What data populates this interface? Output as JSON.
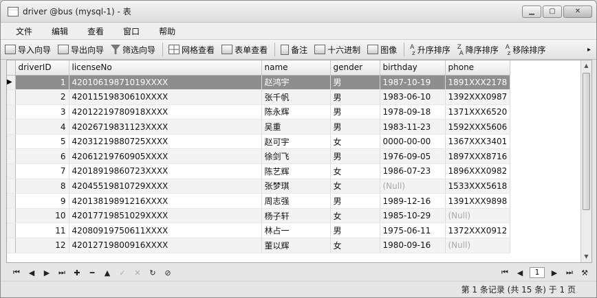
{
  "window": {
    "title": "driver @bus (mysql-1) - 表"
  },
  "menu": [
    "文件",
    "编辑",
    "查看",
    "窗口",
    "帮助"
  ],
  "toolbar": {
    "import_wizard": "导入向导",
    "export_wizard": "导出向导",
    "filter_wizard": "筛选向导",
    "grid_view": "网格查看",
    "form_view": "表单查看",
    "memo": "备注",
    "hex": "十六进制",
    "image": "图像",
    "sort_asc": "升序排序",
    "sort_desc": "降序排序",
    "remove_sort": "移除排序"
  },
  "table": {
    "columns": [
      "driverID",
      "licenseNo",
      "name",
      "gender",
      "birthday",
      "phone"
    ],
    "rows": [
      [
        "1",
        "42010619871019XXXX",
        "赵鸿宇",
        "男",
        "1987-10-19",
        "1891XXX2178"
      ],
      [
        "2",
        "42011519830610XXXX",
        "张千帆",
        "男",
        "1983-06-10",
        "1392XXX0987"
      ],
      [
        "3",
        "42012219780918XXXX",
        "陈永辉",
        "男",
        "1978-09-18",
        "1371XXX6520"
      ],
      [
        "4",
        "42026719831123XXXX",
        "吴重",
        "男",
        "1983-11-23",
        "1592XXX5606"
      ],
      [
        "5",
        "42031219880725XXXX",
        "赵可宇",
        "女",
        "0000-00-00",
        "1367XXX3401"
      ],
      [
        "6",
        "42061219760905XXXX",
        "徐剑飞",
        "男",
        "1976-09-05",
        "1897XXX8716"
      ],
      [
        "7",
        "42018919860723XXXX",
        "陈艺辉",
        "女",
        "1986-07-23",
        "1896XXX0982"
      ],
      [
        "8",
        "42045519810729XXXX",
        "张梦琪",
        "女",
        "(Null)",
        "1533XXX5618"
      ],
      [
        "9",
        "42013819891216XXXX",
        "周志强",
        "男",
        "1989-12-16",
        "1391XXX9898"
      ],
      [
        "10",
        "42017719851029XXXX",
        "杨子轩",
        "女",
        "1985-10-29",
        "(Null)"
      ],
      [
        "11",
        "42080919750611XXXX",
        "林占一",
        "男",
        "1975-06-11",
        "1372XXX0912"
      ],
      [
        "12",
        "42012719800916XXXX",
        "董以辉",
        "女",
        "1980-09-16",
        "(Null)"
      ]
    ],
    "selected_row": 0,
    "null_text": "(Null)"
  },
  "navigation": {
    "page": "1"
  },
  "status": {
    "text": "第 1 条记录 (共 15 条) 于 1 页"
  }
}
